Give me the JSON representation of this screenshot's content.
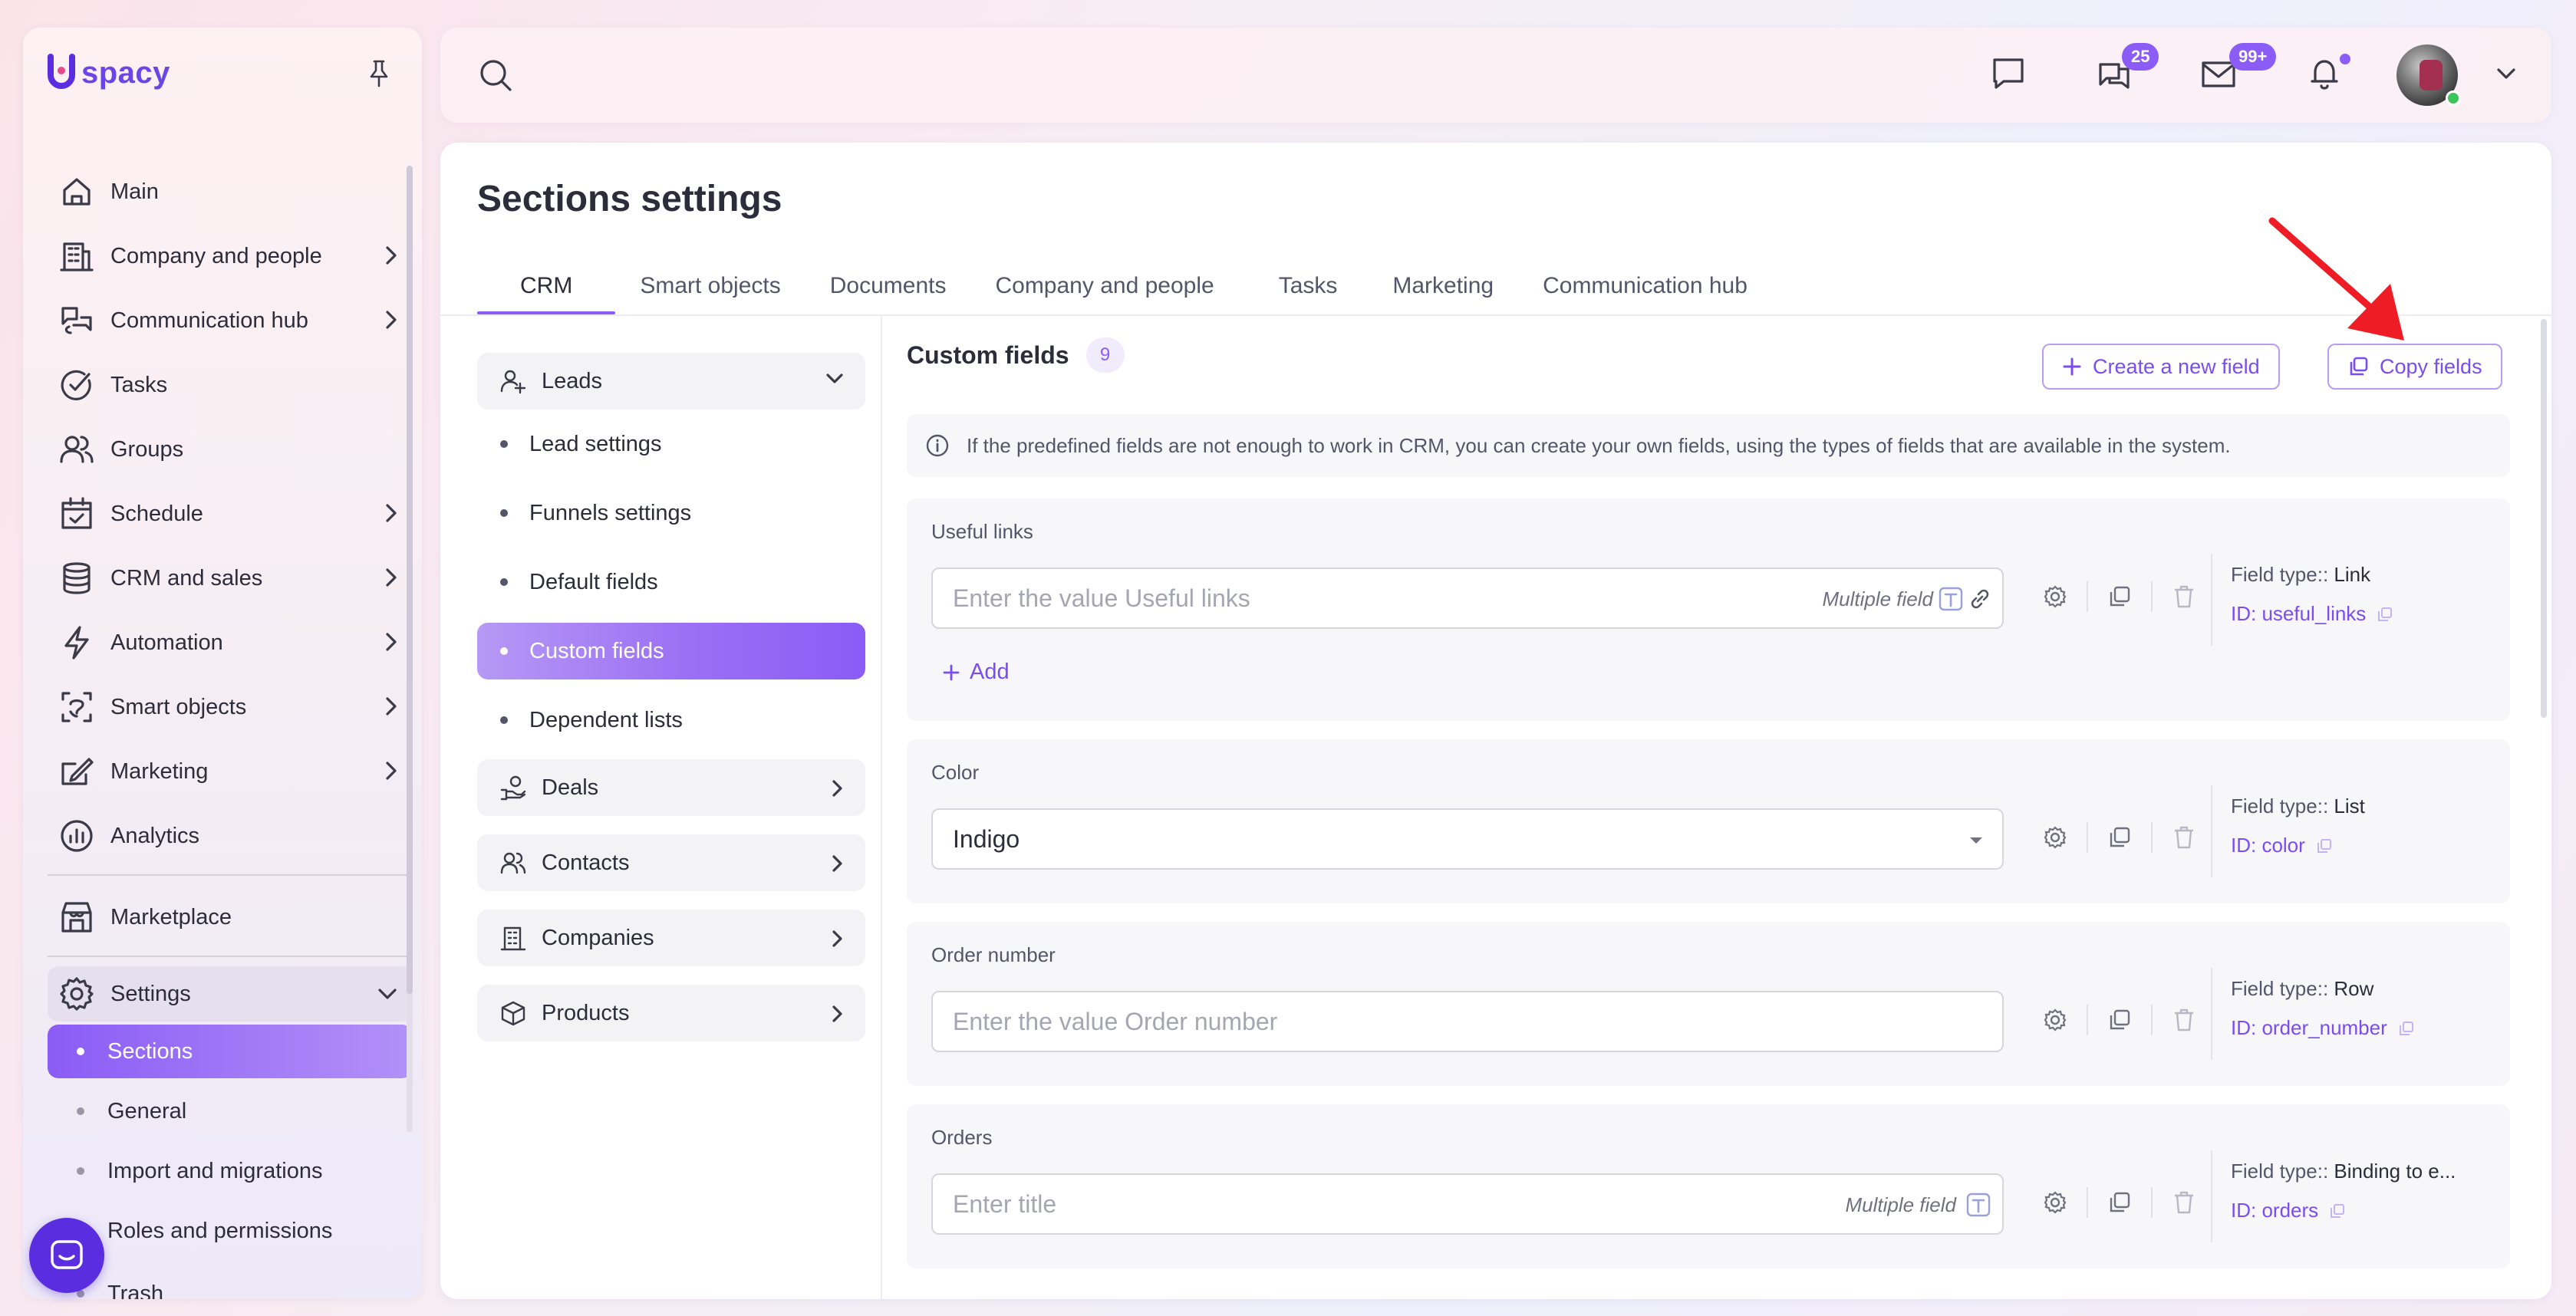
{
  "app": {
    "logo_text": "spacy",
    "brand_color": "#8b5cf6"
  },
  "sidebar": {
    "items": [
      {
        "label": "Main",
        "icon": "home-icon",
        "has_children": false
      },
      {
        "label": "Company and people",
        "icon": "building-icon",
        "has_children": true
      },
      {
        "label": "Communication hub",
        "icon": "communication-icon",
        "has_children": true
      },
      {
        "label": "Tasks",
        "icon": "check-circle-icon",
        "has_children": false
      },
      {
        "label": "Groups",
        "icon": "users-icon",
        "has_children": false
      },
      {
        "label": "Schedule",
        "icon": "calendar-icon",
        "has_children": true
      },
      {
        "label": "CRM and sales",
        "icon": "database-icon",
        "has_children": true
      },
      {
        "label": "Automation",
        "icon": "lightning-icon",
        "has_children": true
      },
      {
        "label": "Smart objects",
        "icon": "smart-object-icon",
        "has_children": true
      },
      {
        "label": "Marketing",
        "icon": "marketing-icon",
        "has_children": true
      },
      {
        "label": "Analytics",
        "icon": "chart-icon",
        "has_children": false
      }
    ],
    "marketplace": "Marketplace",
    "settings": "Settings",
    "settings_sub": [
      "Sections",
      "General",
      "Import and migrations",
      "Roles and permissions",
      "Trash"
    ]
  },
  "topbar": {
    "chat_badge": "25",
    "mail_badge": "99+"
  },
  "page": {
    "title": "Sections settings",
    "tabs": [
      "CRM",
      "Smart objects",
      "Documents",
      "Company and people",
      "Tasks",
      "Marketing",
      "Communication hub"
    ]
  },
  "submenu": {
    "leads": "Leads",
    "leads_items": [
      "Lead settings",
      "Funnels settings",
      "Default fields",
      "Custom fields",
      "Dependent lists"
    ],
    "groups": [
      "Deals",
      "Contacts",
      "Companies",
      "Products"
    ]
  },
  "custom_fields": {
    "title": "Custom fields",
    "count": "9",
    "create_button": "Create a new field",
    "copy_button": "Copy fields",
    "info": "If the predefined fields are not enough to work in CRM, you can create your own fields, using the types of fields that are available in the system.",
    "add_label": "Add",
    "multiple_label": "Multiple field",
    "type_prefix": "Field type::",
    "fields": [
      {
        "label": "Useful links",
        "placeholder": "Enter the value Useful links",
        "type": "Link",
        "id": "ID: useful_links"
      },
      {
        "label": "Color",
        "value": "Indigo",
        "type": "List",
        "id": "ID: color"
      },
      {
        "label": "Order number",
        "placeholder": "Enter the value Order number",
        "type": "Row",
        "id": "ID: order_number"
      },
      {
        "label": "Orders",
        "placeholder": "Enter title",
        "type": "Binding to e...",
        "id": "ID: orders"
      }
    ]
  }
}
